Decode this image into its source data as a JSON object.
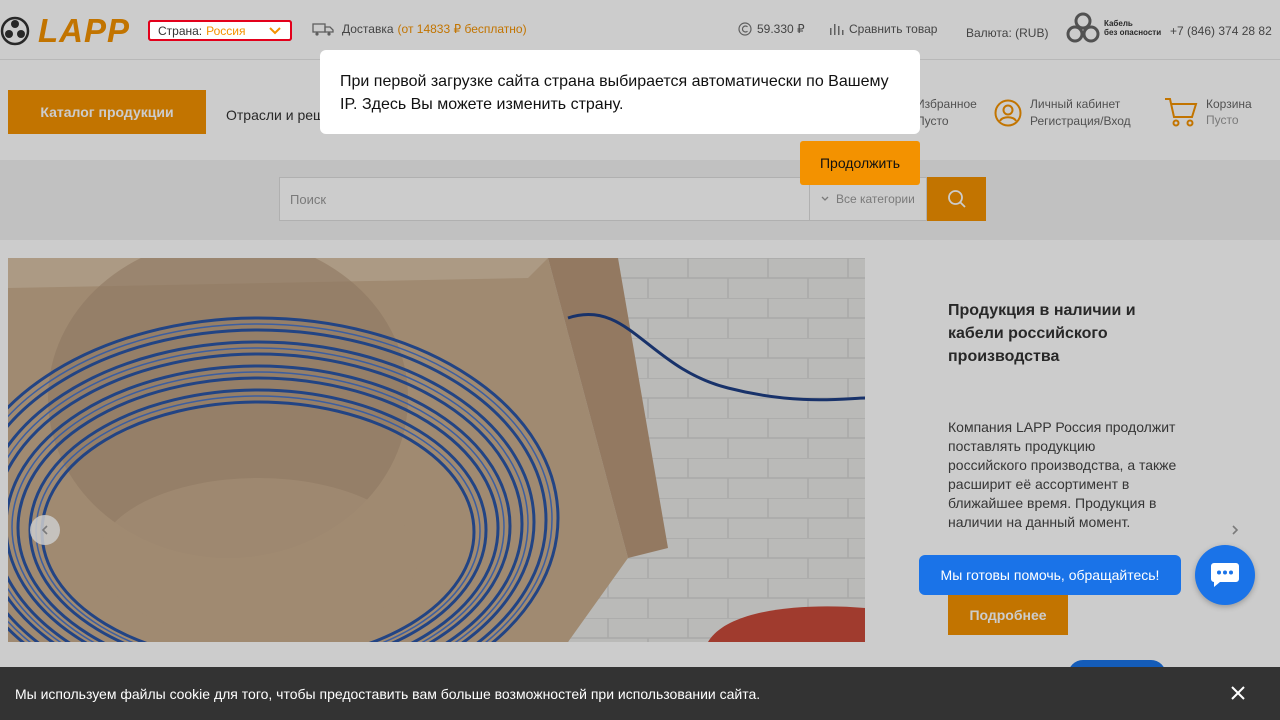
{
  "header": {
    "logo_text": "LAPP",
    "country_label": "Страна:",
    "country_value": "Россия",
    "delivery_label": "Доставка",
    "delivery_note": "(от 14833  ₽ бесплатно)",
    "copper_price": "59.330 ₽",
    "compare_label": "Сравнить товар",
    "currency_label": "Валюта: (RUB)",
    "safety_line1": "Кабель",
    "safety_line2": "без опасности",
    "phone": "+7 (846) 374 28 82"
  },
  "nav": {
    "catalog_button": "Каталог продукции",
    "industries_link": "Отрасли и решения",
    "favorites_line1": "Избранное",
    "favorites_line2": "Пусто",
    "account_line1": "Личный кабинет",
    "account_line2": "Регистрация/Вход",
    "cart_line1": "Корзина",
    "cart_line2": "Пусто"
  },
  "search": {
    "placeholder": "Поиск",
    "category_value": "Все категории"
  },
  "banner": {
    "title": "Продукция в наличии и кабели российского производства",
    "description": "Компания LAPP Россия продолжит поставлять продукцию российского производства, а также расширит её ассортимент в ближайшее время. Продукция в наличии на данный момент.",
    "more_button": "Подробнее"
  },
  "popup": {
    "message": "При первой загрузке сайта страна выбирается автоматически по Вашему IP. Здесь Вы можете изменить страну.",
    "continue_button": "Продолжить"
  },
  "chat": {
    "bubble_text": "Мы готовы помочь, обращайтесь!"
  },
  "cookie": {
    "message": "Мы используем файлы cookie для того, чтобы предоставить вам больше возможностей при использовании сайта."
  },
  "colors": {
    "brand_orange": "#f39200",
    "chat_blue": "#1a73e8",
    "country_border_red": "#e3001b",
    "cookie_bg": "#333333"
  }
}
